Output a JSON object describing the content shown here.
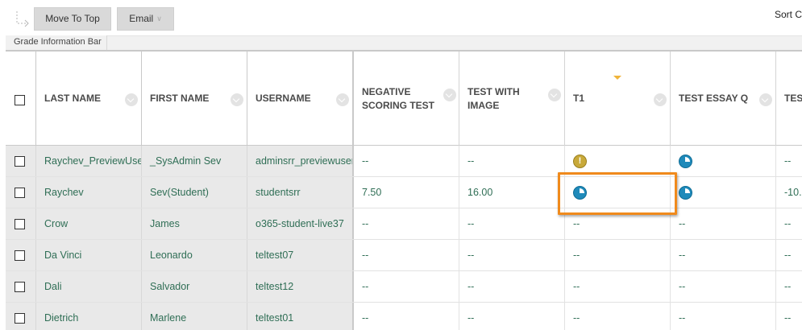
{
  "toolbar": {
    "move_to_top": "Move To Top",
    "email": "Email",
    "sort": "Sort C"
  },
  "info_bar": {
    "label": "Grade Information Bar"
  },
  "columns": [
    {
      "label": "LAST NAME"
    },
    {
      "label": "FIRST NAME"
    },
    {
      "label": "USERNAME"
    },
    {
      "label": "NEGATIVE SCORING TEST"
    },
    {
      "label": "TEST WITH IMAGE"
    },
    {
      "label": "T1"
    },
    {
      "label": "TEST ESSAY Q"
    },
    {
      "label": "TEST TEST"
    }
  ],
  "rows": [
    {
      "last": "Raychev_PreviewUser",
      "first": "_SysAdmin Sev",
      "username": "adminsrr_previewuser",
      "neg": "--",
      "img": "--",
      "t1": "attention-icon",
      "essay": "in-progress-icon",
      "last_col": "--"
    },
    {
      "last": "Raychev",
      "first": "Sev(Student)",
      "username": "studentsrr",
      "neg": "7.50",
      "img": "16.00",
      "t1": "in-progress-icon",
      "essay": "in-progress-icon",
      "last_col": "-10."
    },
    {
      "last": "Crow",
      "first": "James",
      "username": "o365-student-live37",
      "neg": "--",
      "img": "--",
      "t1": "--",
      "essay": "--",
      "last_col": "--"
    },
    {
      "last": "Da Vinci",
      "first": "Leonardo",
      "username": "teltest07",
      "neg": "--",
      "img": "--",
      "t1": "--",
      "essay": "--",
      "last_col": "--"
    },
    {
      "last": "Dali",
      "first": "Salvador",
      "username": "teltest12",
      "neg": "--",
      "img": "--",
      "t1": "--",
      "essay": "--",
      "last_col": "--"
    },
    {
      "last": "Dietrich",
      "first": "Marlene",
      "username": "teltest01",
      "neg": "--",
      "img": "--",
      "t1": "--",
      "essay": "--",
      "last_col": "--"
    }
  ],
  "colors": {
    "link_text": "#2f6e55",
    "frozen_bg": "#e9e9e9",
    "highlight": "#f08a1c",
    "sort_arrow": "#f0b43a",
    "progress_icon": "#1f8aba",
    "attention_icon": "#c8a93a"
  }
}
